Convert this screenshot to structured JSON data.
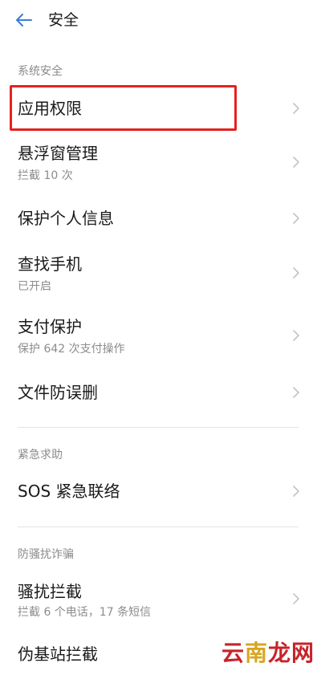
{
  "header": {
    "title": "安全",
    "back_icon": "back-arrow-icon"
  },
  "sections": [
    {
      "header": "系统安全",
      "items": [
        {
          "label": "应用权限",
          "sub": ""
        },
        {
          "label": "悬浮窗管理",
          "sub": "拦截 10 次"
        },
        {
          "label": "保护个人信息",
          "sub": ""
        },
        {
          "label": "查找手机",
          "sub": "已开启"
        },
        {
          "label": "支付保护",
          "sub": "保护 642 次支付操作"
        },
        {
          "label": "文件防误删",
          "sub": ""
        }
      ]
    },
    {
      "header": "紧急求助",
      "items": [
        {
          "label": "SOS 紧急联络",
          "sub": ""
        }
      ]
    },
    {
      "header": "防骚扰诈骗",
      "items": [
        {
          "label": "骚扰拦截",
          "sub": "拦截 6 个电话，17 条短信"
        },
        {
          "label": "伪基站拦截",
          "sub": ""
        }
      ]
    }
  ],
  "watermark": {
    "part1": "云",
    "part2": "南",
    "part3": "龙网"
  },
  "colors": {
    "accent": "#3d7bd9",
    "highlight": "#e6221e",
    "secondary_text": "#8c8c8c"
  }
}
